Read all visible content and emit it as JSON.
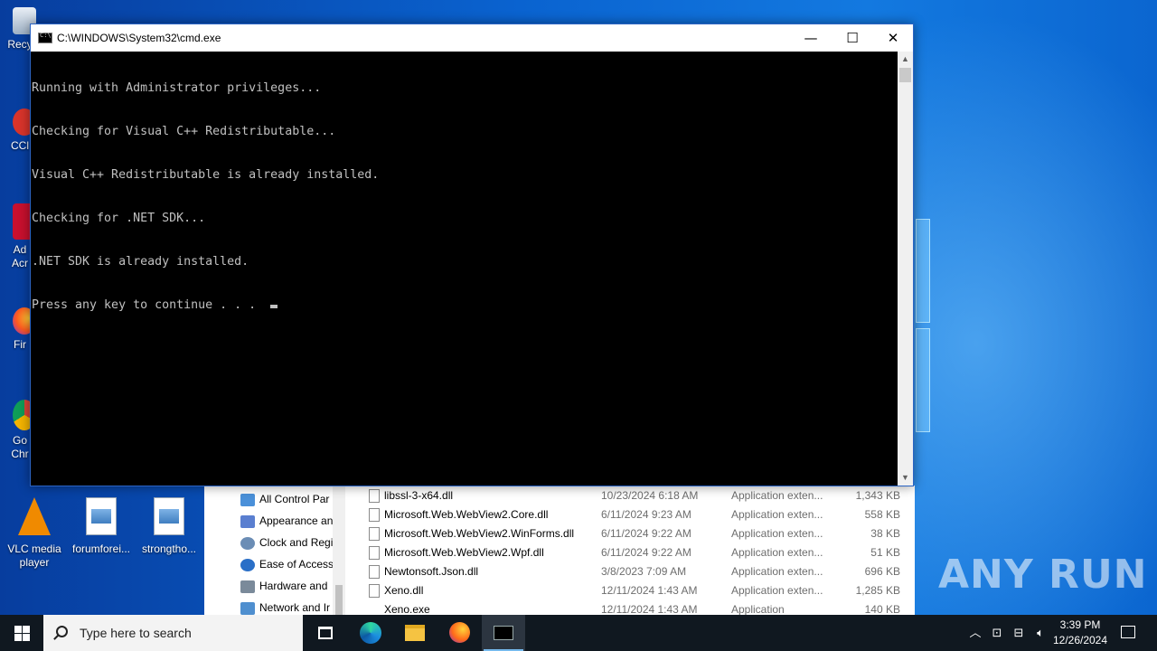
{
  "desktop": {
    "icons": [
      {
        "label": "Recy",
        "icon": "recycle-bin-icon"
      },
      {
        "label": "CCl",
        "icon": "ccleaner-icon"
      },
      {
        "label": "Ad\nAcr",
        "icon": "adobe-acrobat-icon"
      },
      {
        "label": "Fir",
        "icon": "firefox-icon"
      },
      {
        "label": "Go\nChr",
        "icon": "chrome-icon"
      },
      {
        "label": "VLC media player",
        "icon": "vlc-icon"
      },
      {
        "label": "forumforei...",
        "icon": "image-file-icon"
      },
      {
        "label": "strongtho...",
        "icon": "image-file-icon"
      }
    ],
    "watermark": "ANY RUN"
  },
  "cmd_window": {
    "title": "C:\\WINDOWS\\System32\\cmd.exe",
    "buttons": {
      "minimize": "—",
      "maximize": "☐",
      "close": "✕"
    },
    "lines": [
      "Running with Administrator privileges...",
      "Checking for Visual C++ Redistributable...",
      "Visual C++ Redistributable is already installed.",
      "Checking for .NET SDK...",
      ".NET SDK is already installed.",
      "Press any key to continue . . . "
    ]
  },
  "explorer": {
    "nav": [
      {
        "label": "All Control Par",
        "color": "#4a90d9"
      },
      {
        "label": "Appearance an",
        "color": "#5a7fd0"
      },
      {
        "label": "Clock and Regi",
        "color": "#6b8db5"
      },
      {
        "label": "Ease of Access",
        "color": "#2a6fc7"
      },
      {
        "label": "Hardware and",
        "color": "#7a8a9a"
      },
      {
        "label": "Network and Ir",
        "color": "#4f8fcf"
      }
    ],
    "files": [
      {
        "name": "libssl-3-x64.dll",
        "date": "10/23/2024 6:18 AM",
        "type": "Application exten...",
        "size": "1,343 KB"
      },
      {
        "name": "Microsoft.Web.WebView2.Core.dll",
        "date": "6/11/2024 9:23 AM",
        "type": "Application exten...",
        "size": "558 KB"
      },
      {
        "name": "Microsoft.Web.WebView2.WinForms.dll",
        "date": "6/11/2024 9:22 AM",
        "type": "Application exten...",
        "size": "38 KB"
      },
      {
        "name": "Microsoft.Web.WebView2.Wpf.dll",
        "date": "6/11/2024 9:22 AM",
        "type": "Application exten...",
        "size": "51 KB"
      },
      {
        "name": "Newtonsoft.Json.dll",
        "date": "3/8/2023 7:09 AM",
        "type": "Application exten...",
        "size": "696 KB"
      },
      {
        "name": "Xeno.dll",
        "date": "12/11/2024 1:43 AM",
        "type": "Application exten...",
        "size": "1,285 KB"
      },
      {
        "name": "Xeno.exe",
        "date": "12/11/2024 1:43 AM",
        "type": "Application",
        "size": "140 KB"
      }
    ]
  },
  "taskbar": {
    "search_placeholder": "Type here to search",
    "time": "3:39 PM",
    "date": "12/26/2024"
  }
}
